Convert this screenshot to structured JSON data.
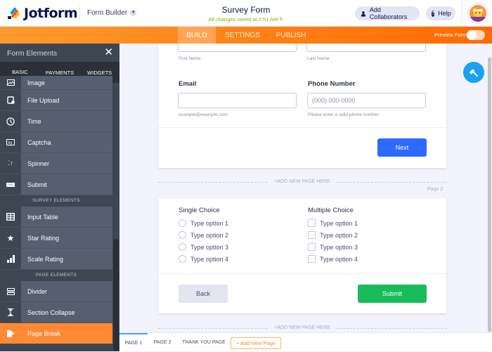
{
  "app": {
    "brand": "Jotform",
    "section": "Form Builder",
    "form_title": "Survey Form",
    "save_status": "All changes saved at 2:51 AM",
    "add_collaborators": "Add Collaborators",
    "help": "Help"
  },
  "nav": {
    "tabs": [
      {
        "label": "BUILD",
        "active": true
      },
      {
        "label": "SETTINGS",
        "active": false
      },
      {
        "label": "PUBLISH",
        "active": false
      }
    ],
    "preview_label": "Preview Form",
    "preview_on": false
  },
  "sidebar": {
    "title": "Form Elements",
    "tabs": [
      {
        "label": "BASIC",
        "active": true
      },
      {
        "label": "PAYMENTS",
        "active": false
      },
      {
        "label": "WIDGETS",
        "active": false
      }
    ],
    "basic_items": [
      {
        "label": "Image",
        "icon": "image-icon"
      },
      {
        "label": "File Upload",
        "icon": "file-upload-icon"
      },
      {
        "label": "Time",
        "icon": "clock-icon"
      },
      {
        "label": "Captcha",
        "icon": "captcha-icon"
      },
      {
        "label": "Spinner",
        "icon": "spinner-icon"
      },
      {
        "label": "Submit",
        "icon": "submit-icon"
      }
    ],
    "survey_heading": "SURVEY ELEMENTS",
    "survey_items": [
      {
        "label": "Input Table",
        "icon": "table-icon"
      },
      {
        "label": "Star Rating",
        "icon": "star-icon"
      },
      {
        "label": "Scale Rating",
        "icon": "bar-chart-icon"
      }
    ],
    "page_heading": "PAGE ELEMENTS",
    "page_items": [
      {
        "label": "Divider",
        "icon": "divider-icon"
      },
      {
        "label": "Section Collapse",
        "icon": "section-collapse-icon"
      },
      {
        "label": "Page Break",
        "icon": "page-break-icon",
        "active": true
      }
    ]
  },
  "form": {
    "page1": {
      "first_name_sub": "First Name",
      "last_name_sub": "Last Name",
      "email_label": "Email",
      "email_sub": "example@example.com",
      "phone_label": "Phone Number",
      "phone_placeholder": "(000) 000-0000",
      "phone_sub": "Please enter a valid phone number.",
      "next_button": "Next"
    },
    "add_page_here": "+ADD NEW PAGE HERE",
    "page2_label": "Page 2",
    "page2": {
      "single_choice_label": "Single Choice",
      "single_options": [
        "Type option 1",
        "Type option 2",
        "Type option 3",
        "Type option 4"
      ],
      "multiple_choice_label": "Multiple Choice",
      "multiple_options": [
        "Type option 1",
        "Type option 2",
        "Type option 3",
        "Type option 4"
      ],
      "back_button": "Back",
      "submit_button": "Submit"
    }
  },
  "pages_bar": {
    "tabs": [
      {
        "label": "PAGE 1",
        "active": true
      },
      {
        "label": "PAGE 2",
        "active": false
      },
      {
        "label": "THANK YOU PAGE",
        "active": false
      }
    ],
    "add_new_page": "+ Add New Page"
  },
  "colors": {
    "brand_orange": "#ff6100",
    "next_blue": "#2e69ff",
    "submit_green": "#18bd5b",
    "paint_fab": "#1aa1f2"
  }
}
